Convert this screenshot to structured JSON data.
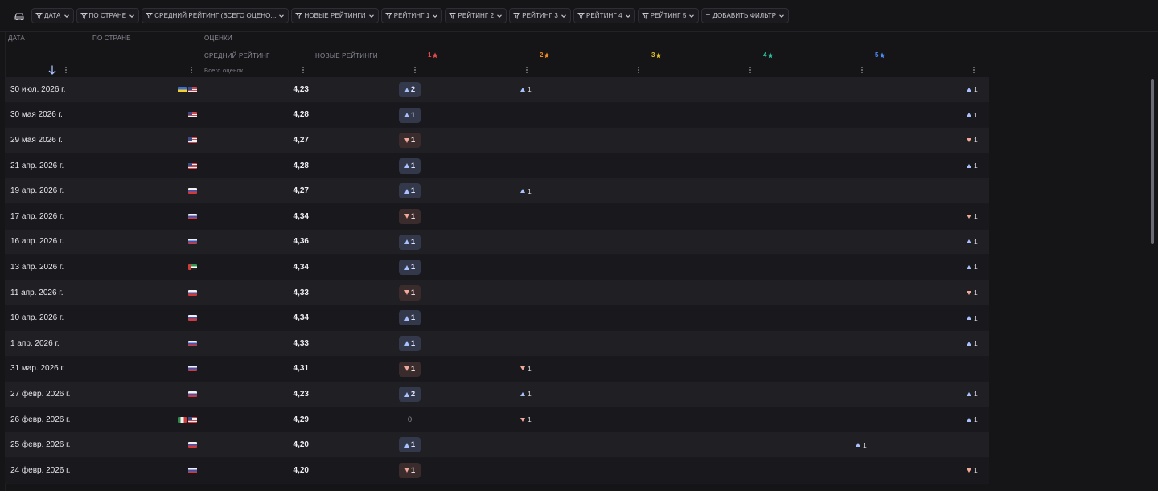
{
  "filters": [
    {
      "label": "Дата"
    },
    {
      "label": "По стране"
    },
    {
      "label": "Средний рейтинг (всего оцено..."
    },
    {
      "label": "Новые рейтинги"
    },
    {
      "label": "Рейтинг 1"
    },
    {
      "label": "Рейтинг 2"
    },
    {
      "label": "Рейтинг 3"
    },
    {
      "label": "Рейтинг 4"
    },
    {
      "label": "Рейтинг 5"
    }
  ],
  "add_filter_label": "Добавить фильтр",
  "headers": {
    "date": "Дата",
    "country": "По стране",
    "ratings_group": "Оценки",
    "avg_rating": "Средний рейтинг",
    "avg_rating_sub": "Всего оценок",
    "new_ratings": "Новые рейтинги",
    "stars": [
      {
        "label": "1",
        "color": "#e5484d"
      },
      {
        "label": "2",
        "color": "#f08a24"
      },
      {
        "label": "3",
        "color": "#e6c229"
      },
      {
        "label": "4",
        "color": "#2fbfa0"
      },
      {
        "label": "5",
        "color": "#4d8cf5"
      }
    ]
  },
  "sort": "descending",
  "rows": [
    {
      "date": "30 июл. 2026 г.",
      "flags": [
        "ua",
        "us"
      ],
      "avg": "4,23",
      "new": {
        "dir": "up",
        "value": "2"
      },
      "changes": [
        {
          "star": 1,
          "dir": "up",
          "value": "1"
        },
        {
          "star": 5,
          "dir": "up",
          "value": "1"
        }
      ]
    },
    {
      "date": "30 мая 2026 г.",
      "flags": [
        "us"
      ],
      "avg": "4,28",
      "new": {
        "dir": "up",
        "value": "1"
      },
      "changes": [
        {
          "star": 5,
          "dir": "up",
          "value": "1"
        }
      ]
    },
    {
      "date": "29 мая 2026 г.",
      "flags": [
        "us"
      ],
      "avg": "4,27",
      "new": {
        "dir": "down",
        "value": "1"
      },
      "changes": [
        {
          "star": 5,
          "dir": "down",
          "value": "1"
        }
      ]
    },
    {
      "date": "21 апр. 2026 г.",
      "flags": [
        "us"
      ],
      "avg": "4,28",
      "new": {
        "dir": "up",
        "value": "1"
      },
      "changes": [
        {
          "star": 5,
          "dir": "up",
          "value": "1"
        }
      ]
    },
    {
      "date": "19 апр. 2026 г.",
      "flags": [
        "ru"
      ],
      "avg": "4,27",
      "new": {
        "dir": "up",
        "value": "1"
      },
      "changes": [
        {
          "star": 1,
          "dir": "up",
          "value": "1"
        }
      ]
    },
    {
      "date": "17 апр. 2026 г.",
      "flags": [
        "ru"
      ],
      "avg": "4,34",
      "new": {
        "dir": "down",
        "value": "1"
      },
      "changes": [
        {
          "star": 5,
          "dir": "down",
          "value": "1"
        }
      ]
    },
    {
      "date": "16 апр. 2026 г.",
      "flags": [
        "ru"
      ],
      "avg": "4,36",
      "new": {
        "dir": "up",
        "value": "1"
      },
      "changes": [
        {
          "star": 5,
          "dir": "up",
          "value": "1"
        }
      ]
    },
    {
      "date": "13 апр. 2026 г.",
      "flags": [
        "ae"
      ],
      "avg": "4,34",
      "new": {
        "dir": "up",
        "value": "1"
      },
      "changes": [
        {
          "star": 5,
          "dir": "up",
          "value": "1"
        }
      ]
    },
    {
      "date": "11 апр. 2026 г.",
      "flags": [
        "ru"
      ],
      "avg": "4,33",
      "new": {
        "dir": "down",
        "value": "1"
      },
      "changes": [
        {
          "star": 5,
          "dir": "down",
          "value": "1"
        }
      ]
    },
    {
      "date": "10 апр. 2026 г.",
      "flags": [
        "ru"
      ],
      "avg": "4,34",
      "new": {
        "dir": "up",
        "value": "1"
      },
      "changes": [
        {
          "star": 5,
          "dir": "up",
          "value": "1"
        }
      ]
    },
    {
      "date": "1 апр. 2026 г.",
      "flags": [
        "ru"
      ],
      "avg": "4,33",
      "new": {
        "dir": "up",
        "value": "1"
      },
      "changes": [
        {
          "star": 5,
          "dir": "up",
          "value": "1"
        }
      ]
    },
    {
      "date": "31 мар. 2026 г.",
      "flags": [
        "ru"
      ],
      "avg": "4,31",
      "new": {
        "dir": "down",
        "value": "1"
      },
      "changes": [
        {
          "star": 1,
          "dir": "down",
          "value": "1"
        }
      ]
    },
    {
      "date": "27 февр. 2026 г.",
      "flags": [
        "ru"
      ],
      "avg": "4,23",
      "new": {
        "dir": "up",
        "value": "2"
      },
      "changes": [
        {
          "star": 1,
          "dir": "up",
          "value": "1"
        },
        {
          "star": 5,
          "dir": "up",
          "value": "1"
        }
      ]
    },
    {
      "date": "26 февр. 2026 г.",
      "flags": [
        "mx",
        "us"
      ],
      "avg": "4,29",
      "new": {
        "dir": "zero",
        "value": "0"
      },
      "changes": [
        {
          "star": 1,
          "dir": "down",
          "value": "1"
        },
        {
          "star": 5,
          "dir": "up",
          "value": "1"
        }
      ]
    },
    {
      "date": "25 февр. 2026 г.",
      "flags": [
        "ru"
      ],
      "avg": "4,20",
      "new": {
        "dir": "up",
        "value": "1"
      },
      "changes": [
        {
          "star": 4,
          "dir": "up",
          "value": "1"
        }
      ]
    },
    {
      "date": "24 февр. 2026 г.",
      "flags": [
        "ru"
      ],
      "avg": "4,20",
      "new": {
        "dir": "down",
        "value": "1"
      },
      "changes": [
        {
          "star": 5,
          "dir": "down",
          "value": "1"
        }
      ]
    }
  ]
}
